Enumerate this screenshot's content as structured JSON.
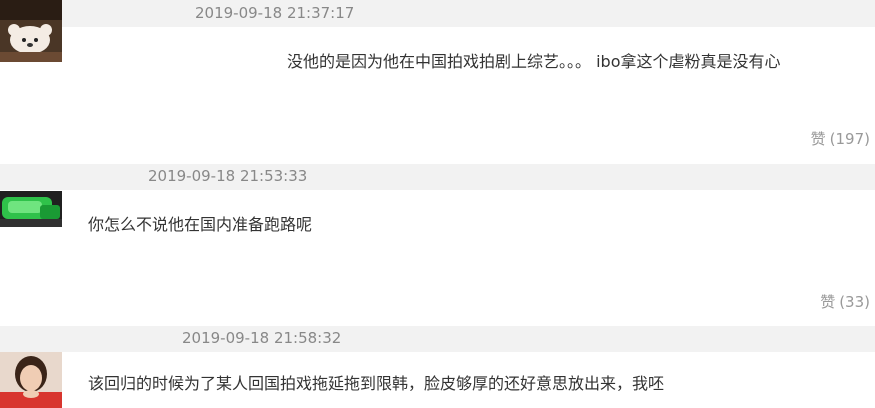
{
  "comments": [
    {
      "timestamp": "2019-09-18 21:37:17",
      "text": "没他的是因为他在中国拍戏拍剧上综艺。。。 ibo拿这个虐粉真是没有心",
      "like_label": "赞",
      "like_count": "(197)"
    },
    {
      "timestamp": "2019-09-18 21:53:33",
      "text": "你怎么不说他在国内准备跑路呢",
      "like_label": "赞",
      "like_count": "(33)"
    },
    {
      "timestamp": "2019-09-18 21:58:32",
      "text": "该回归的时候为了某人回国拍戏拖延拖到限韩，脸皮够厚的还好意思放出来，我呸"
    }
  ],
  "colors": {
    "meta_bar": "#f2f2f2",
    "timestamp": "#888888",
    "text": "#333333",
    "like": "#999999"
  }
}
